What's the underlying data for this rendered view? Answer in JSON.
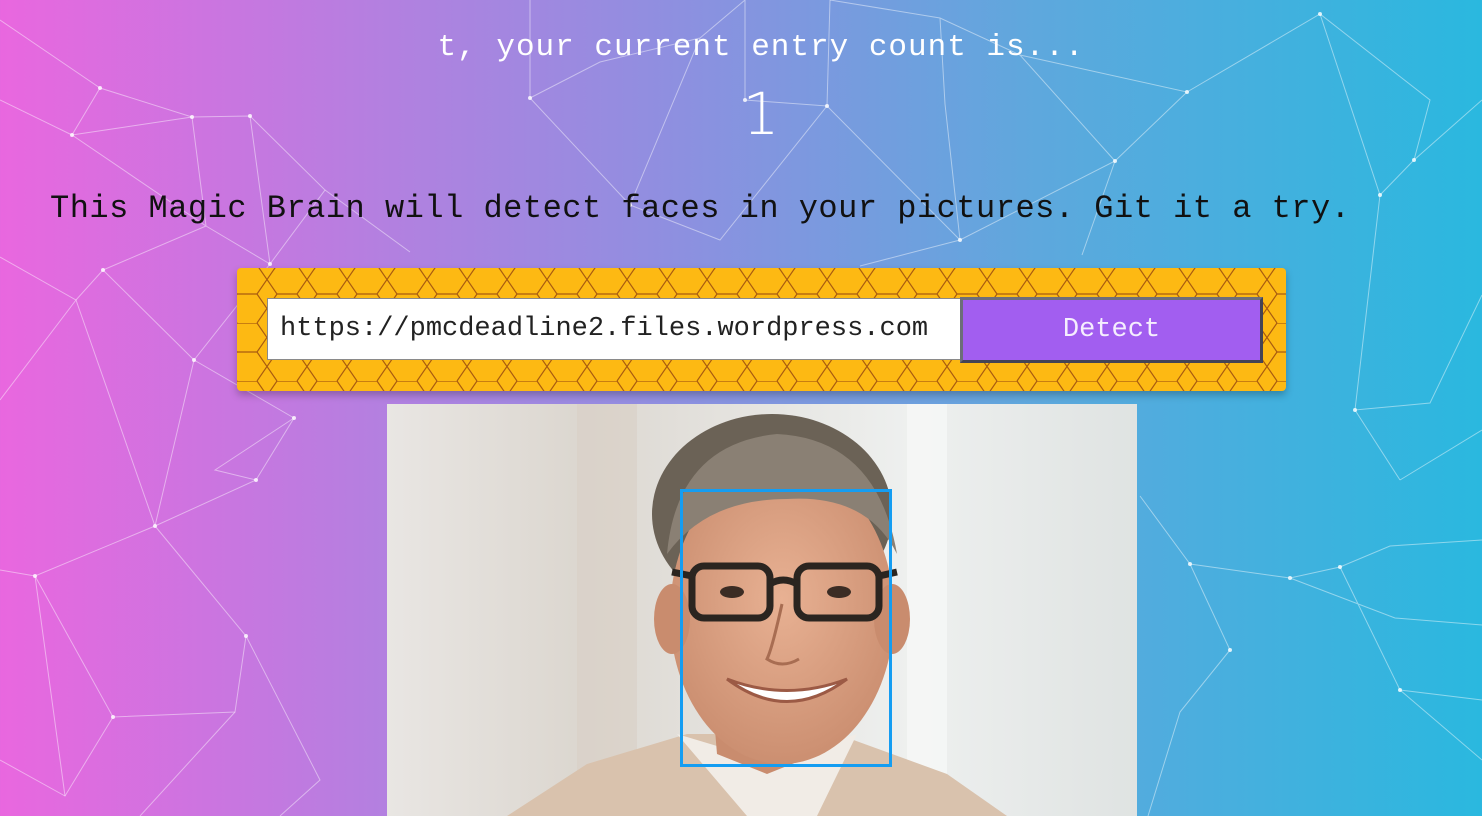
{
  "rank": {
    "message": "t, your current entry count is...",
    "count": "1"
  },
  "intro": {
    "text": "This Magic Brain will detect faces in your pictures. Git it a try."
  },
  "form": {
    "url_value": "https://pmcdeadline2.files.wordpress.com",
    "detect_label": "Detect"
  },
  "colors": {
    "gradient_start": "#e967df",
    "gradient_end": "#2ab8df",
    "form_background": "#fdb913",
    "button_background": "#a25ef0",
    "face_box_border": "#149df2"
  },
  "icons": {
    "background": "particle-network",
    "panel_pattern": "honeycomb-pattern"
  }
}
